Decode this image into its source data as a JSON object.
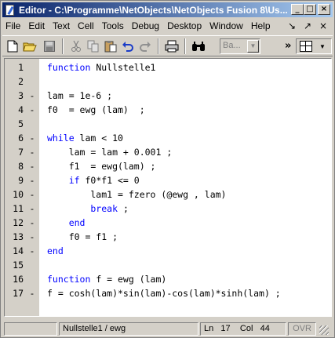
{
  "window": {
    "title": "Editor - C:\\Programme\\NetObjects\\NetObjects Fusion 8\\Us...",
    "controls": {
      "minimize": "_",
      "maximize": "□",
      "close": "×"
    }
  },
  "menubar": {
    "items": [
      "File",
      "Edit",
      "Text",
      "Cell",
      "Tools",
      "Debug",
      "Desktop",
      "Window",
      "Help"
    ],
    "right_icons": [
      "↘",
      "↗",
      "×"
    ]
  },
  "toolbar": {
    "tools": [
      "new-file-icon",
      "open-folder-icon",
      "save-icon",
      "cut-icon",
      "copy-icon",
      "paste-icon",
      "undo-icon",
      "redo-icon",
      "print-icon",
      "find-icon"
    ],
    "combo_value": "Ba...",
    "overflow": "»"
  },
  "editor": {
    "lines": [
      {
        "num": "1",
        "dash": "",
        "code": [
          [
            "kw",
            "function"
          ],
          [
            "",
            "Nullstelle1"
          ]
        ]
      },
      {
        "num": "2",
        "dash": "",
        "code": []
      },
      {
        "num": "3",
        "dash": "-",
        "code": [
          [
            "",
            "lam = 1e-6 ;"
          ]
        ]
      },
      {
        "num": "4",
        "dash": "-",
        "code": [
          [
            "",
            "f0  = ewg (lam)  ;"
          ]
        ]
      },
      {
        "num": "5",
        "dash": "",
        "code": []
      },
      {
        "num": "6",
        "dash": "-",
        "code": [
          [
            "kw",
            "while"
          ],
          [
            "",
            "lam < 10"
          ]
        ]
      },
      {
        "num": "7",
        "dash": "-",
        "code": [
          [
            "",
            "    lam = lam + 0.001 ;"
          ]
        ]
      },
      {
        "num": "8",
        "dash": "-",
        "code": [
          [
            "",
            "    f1  = ewg(lam) ;"
          ]
        ]
      },
      {
        "num": "9",
        "dash": "-",
        "code": [
          [
            "kw",
            "    if"
          ],
          [
            "",
            "f0*f1 <= 0"
          ]
        ]
      },
      {
        "num": "10",
        "dash": "-",
        "code": [
          [
            "",
            "        lam1 = fzero (@ewg , lam)"
          ]
        ]
      },
      {
        "num": "11",
        "dash": "-",
        "code": [
          [
            "kw",
            "        break"
          ],
          [
            "",
            " ;"
          ]
        ]
      },
      {
        "num": "12",
        "dash": "-",
        "code": [
          [
            "kw",
            "    end"
          ]
        ]
      },
      {
        "num": "13",
        "dash": "-",
        "code": [
          [
            "",
            "    f0 = f1 ;"
          ]
        ]
      },
      {
        "num": "14",
        "dash": "-",
        "code": [
          [
            "kw",
            "end"
          ]
        ]
      },
      {
        "num": "15",
        "dash": "",
        "code": []
      },
      {
        "num": "16",
        "dash": "",
        "code": [
          [
            "kw",
            "function"
          ],
          [
            "",
            "f = ewg (lam)"
          ]
        ]
      },
      {
        "num": "17",
        "dash": "-",
        "code": [
          [
            "",
            "f = cosh(lam)*sin(lam)-cos(lam)*sinh(lam) ;"
          ]
        ]
      }
    ]
  },
  "statusbar": {
    "file": "Nullstelle1 / ewg",
    "ln_label": "Ln",
    "ln_value": "17",
    "col_label": "Col",
    "col_value": "44",
    "ovr": "OVR"
  },
  "colors": {
    "keyword": "#0000ff",
    "title_start": "#0a246a",
    "title_end": "#a6caf0"
  }
}
